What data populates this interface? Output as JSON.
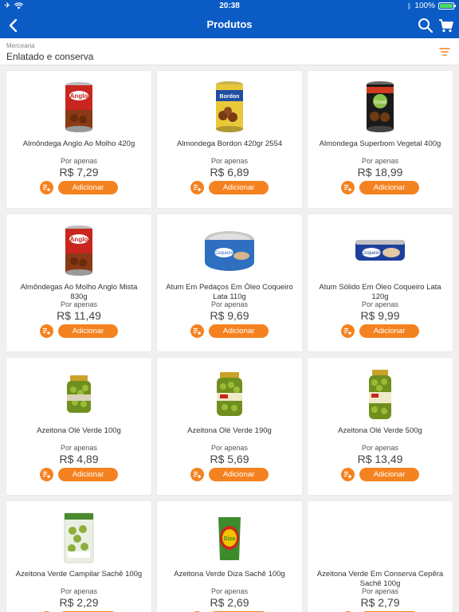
{
  "status_bar": {
    "time": "20:38",
    "battery": "100%"
  },
  "header": {
    "title": "Produtos",
    "back_icon": "back-chevron-icon",
    "search_icon": "search-icon",
    "cart_icon": "cart-icon"
  },
  "category": {
    "parent": "Mercearia",
    "name": "Enlatado e conserva",
    "filter_icon": "sort-filter-icon"
  },
  "colors": {
    "header_blue": "#0b5bc4",
    "accent_orange": "#f58220"
  },
  "products": [
    {
      "name": "Almôndega Anglo Ao Molho 420g",
      "por_apenas": "Por apenas",
      "price": "R$ 7,29",
      "add_label": "Adicionar",
      "image": "can-anglo"
    },
    {
      "name": "Almondega Bordon 420gr 2554",
      "por_apenas": "Por apenas",
      "price": "R$ 6,89",
      "add_label": "Adicionar",
      "image": "can-bordon"
    },
    {
      "name": "Almondega Superbom Vegetal 400g",
      "por_apenas": "Por apenas",
      "price": "R$ 18,99",
      "add_label": "Adicionar",
      "image": "can-superbom"
    },
    {
      "name": "Almôndegas Ao Molho Anglo Mista 830g",
      "por_apenas": "Por apenas",
      "price": "R$ 11,49",
      "add_label": "Adicionar",
      "image": "can-anglo"
    },
    {
      "name": "Atum Em Pedaços Em Óleo Coqueiro Lata 110g",
      "por_apenas": "Por apenas",
      "price": "R$ 9,69",
      "add_label": "Adicionar",
      "image": "tuna-round"
    },
    {
      "name": "Atum Sólido Em Óleo Coqueiro Lata 120g",
      "por_apenas": "Por apenas",
      "price": "R$ 9,99",
      "add_label": "Adicionar",
      "image": "tuna-flat"
    },
    {
      "name": "Azeitona Olé Verde 100g",
      "por_apenas": "Por apenas",
      "price": "R$ 4,89",
      "add_label": "Adicionar",
      "image": "jar-small"
    },
    {
      "name": "Azeitona Olé Verde 190g",
      "por_apenas": "Por apenas",
      "price": "R$ 5,69",
      "add_label": "Adicionar",
      "image": "jar-medium"
    },
    {
      "name": "Azeitona Olé Verde 500g",
      "por_apenas": "Por apenas",
      "price": "R$ 13,49",
      "add_label": "Adicionar",
      "image": "jar-tall"
    },
    {
      "name": "Azeitona Verde Campilar Sachê 100g",
      "por_apenas": "Por apenas",
      "price": "R$ 2,29",
      "add_label": "Adicionar",
      "image": "pouch-clear"
    },
    {
      "name": "Azeitona Verde Diza Sachê 100g",
      "por_apenas": "Por apenas",
      "price": "R$ 2,69",
      "add_label": "Adicionar",
      "image": "pouch-green"
    },
    {
      "name": "Azeitona Verde Em Conserva Cepêra Sachê 100g",
      "por_apenas": "Por apenas",
      "price": "R$ 2,79",
      "add_label": "Adicionar",
      "image": "none"
    }
  ]
}
